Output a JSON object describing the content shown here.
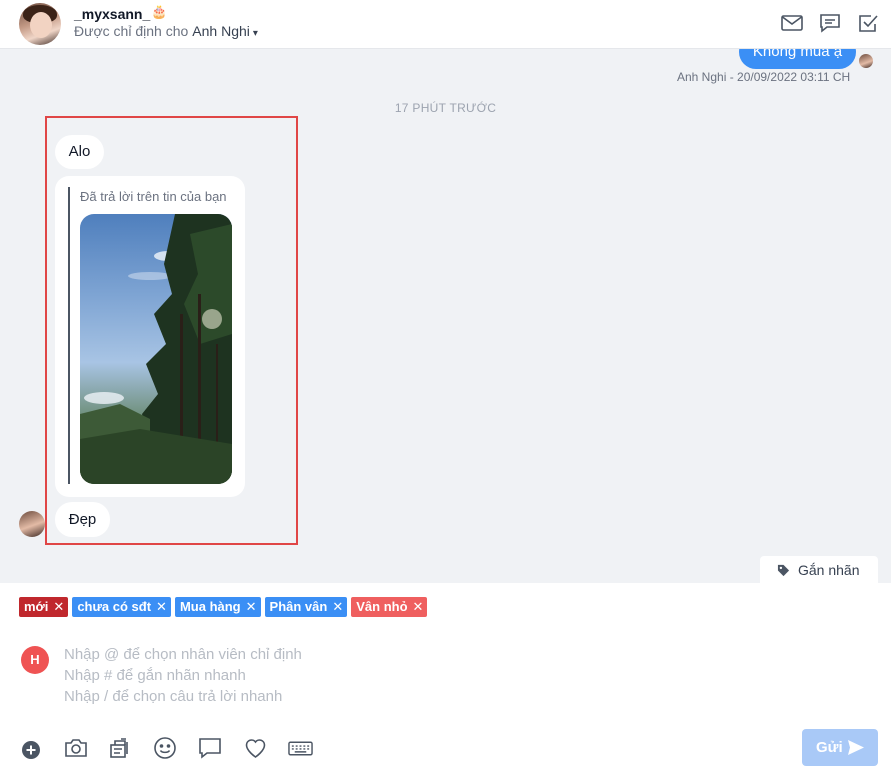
{
  "header": {
    "username": "_myxsann_",
    "assign_prefix": "Được chỉ định cho",
    "assignee": "Anh Nghi",
    "icons": [
      "mail-icon",
      "comment-icon",
      "check-square-icon"
    ]
  },
  "chat": {
    "outgoing_message": "Không mua ạ",
    "outgoing_meta": "Anh Nghi - 20/09/2022 03:11 CH",
    "time_divider": "17 PHÚT TRƯỚC",
    "incoming_1": "Alo",
    "reply_label": "Đã trả lời trên tin của bạn",
    "incoming_2": "Đẹp",
    "tag_button": "Gắn nhãn"
  },
  "labels": [
    {
      "text": "mới",
      "color": "#c0282d"
    },
    {
      "text": "chưa có sđt",
      "color": "#3b8ff5"
    },
    {
      "text": "Mua hàng",
      "color": "#3b8ff5"
    },
    {
      "text": "Phân vân",
      "color": "#3b8ff5"
    },
    {
      "text": "Vân nhỏ",
      "color": "#ef5f5f"
    }
  ],
  "composer": {
    "avatar_letter": "H",
    "hint_1": "Nhập @ để chọn nhân viên chỉ định",
    "hint_2": "Nhập # để gắn nhãn nhanh",
    "hint_3": "Nhập / để chọn câu trả lời nhanh",
    "send_label": "Gửi"
  },
  "toolbar_icons": [
    "plus-circle-icon",
    "camera-icon",
    "template-icon",
    "emoji-icon",
    "chat-bubble-icon",
    "heart-icon",
    "keyboard-icon"
  ]
}
